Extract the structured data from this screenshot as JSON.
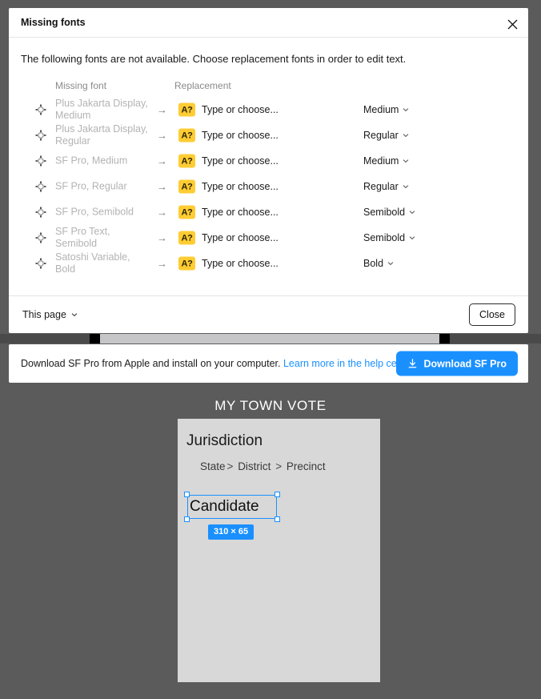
{
  "colors": {
    "accent": "#1a90ff",
    "badge_yellow": "#ffcc33",
    "canvas_bg": "#5b5b5b",
    "frame_bg": "#d8d8d8",
    "dialog_bg": "#ffffff",
    "muted_text": "#b3b3b3"
  },
  "dialog": {
    "title": "Missing fonts",
    "close_icon": "close-icon",
    "description": "The following fonts are not available. Choose replacement fonts in order to edit text.",
    "columns": {
      "missing": "Missing font",
      "replacement": "Replacement"
    },
    "rows": [
      {
        "icon": "target-icon",
        "font": "Plus Jakarta Display, Medium",
        "arrow": "→",
        "badge": "A?",
        "placeholder": "Type or choose...",
        "weight": "Medium"
      },
      {
        "icon": "target-icon",
        "font": "Plus Jakarta Display, Regular",
        "arrow": "→",
        "badge": "A?",
        "placeholder": "Type or choose...",
        "weight": "Regular"
      },
      {
        "icon": "target-icon",
        "font": "SF Pro, Medium",
        "arrow": "→",
        "badge": "A?",
        "placeholder": "Type or choose...",
        "weight": "Medium"
      },
      {
        "icon": "target-icon",
        "font": "SF Pro, Regular",
        "arrow": "→",
        "badge": "A?",
        "placeholder": "Type or choose...",
        "weight": "Regular"
      },
      {
        "icon": "target-icon",
        "font": "SF Pro, Semibold",
        "arrow": "→",
        "badge": "A?",
        "placeholder": "Type or choose...",
        "weight": "Semibold"
      },
      {
        "icon": "target-icon",
        "font": "SF Pro Text, Semibold",
        "arrow": "→",
        "badge": "A?",
        "placeholder": "Type or choose...",
        "weight": "Semibold"
      },
      {
        "icon": "target-icon",
        "font": "Satoshi Variable, Bold",
        "arrow": "→",
        "badge": "A?",
        "placeholder": "Type or choose...",
        "weight": "Bold"
      }
    ],
    "footer": {
      "scope_label": "This page",
      "scope_chevron": "chevron-down-icon",
      "close_label": "Close"
    }
  },
  "banner": {
    "text_before": "Download SF Pro from Apple and install on your computer.",
    "link_label": "Learn more in the help center",
    "button_label": "Download SF Pro",
    "button_icon": "download-icon"
  },
  "canvas": {
    "title": "MY TOWN VOTE",
    "frame": {
      "heading": "Jurisdiction",
      "breadcrumb": {
        "level1": "State",
        "sep1": ">",
        "level2": "District",
        "sep2": ">",
        "level3": "Precinct"
      },
      "selected_text": "Candidate",
      "size_badge": "310 × 65"
    }
  }
}
